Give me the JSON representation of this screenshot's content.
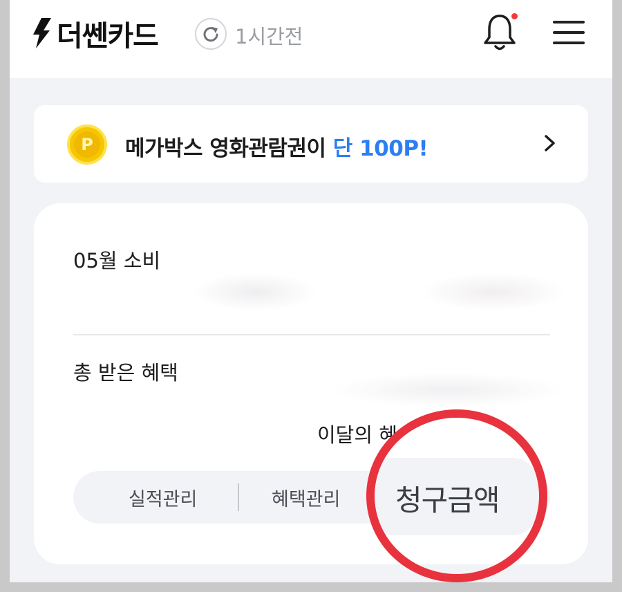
{
  "header": {
    "logo": "더쎈카드",
    "refresh_text": "1시간전",
    "icons": {
      "logo": "lightning-bolt-icon",
      "refresh": "refresh-icon",
      "notifications": "bell-icon",
      "menu": "hamburger-menu-icon"
    },
    "has_unread_notification": true
  },
  "promo": {
    "coin_letter": "P",
    "text_main": "메가박스 영화관람권이 ",
    "text_highlight": "단 100P!",
    "icons": {
      "coin": "point-coin-icon",
      "arrow": "chevron-right-icon"
    }
  },
  "summary_card": {
    "spend_label": "05월 소비",
    "benefit_label": "총 받은 혜택",
    "monthly_benefit_label": "이달의 혜",
    "tabs": [
      {
        "label": "실적관리"
      },
      {
        "label": "혜택관리"
      },
      {
        "label": "청구금액"
      }
    ]
  },
  "colors": {
    "accent_blue": "#2c7ff2",
    "highlight_red": "#e8323e",
    "notification_dot": "#ef3b3b",
    "coin_yellow": "#f6c700"
  }
}
